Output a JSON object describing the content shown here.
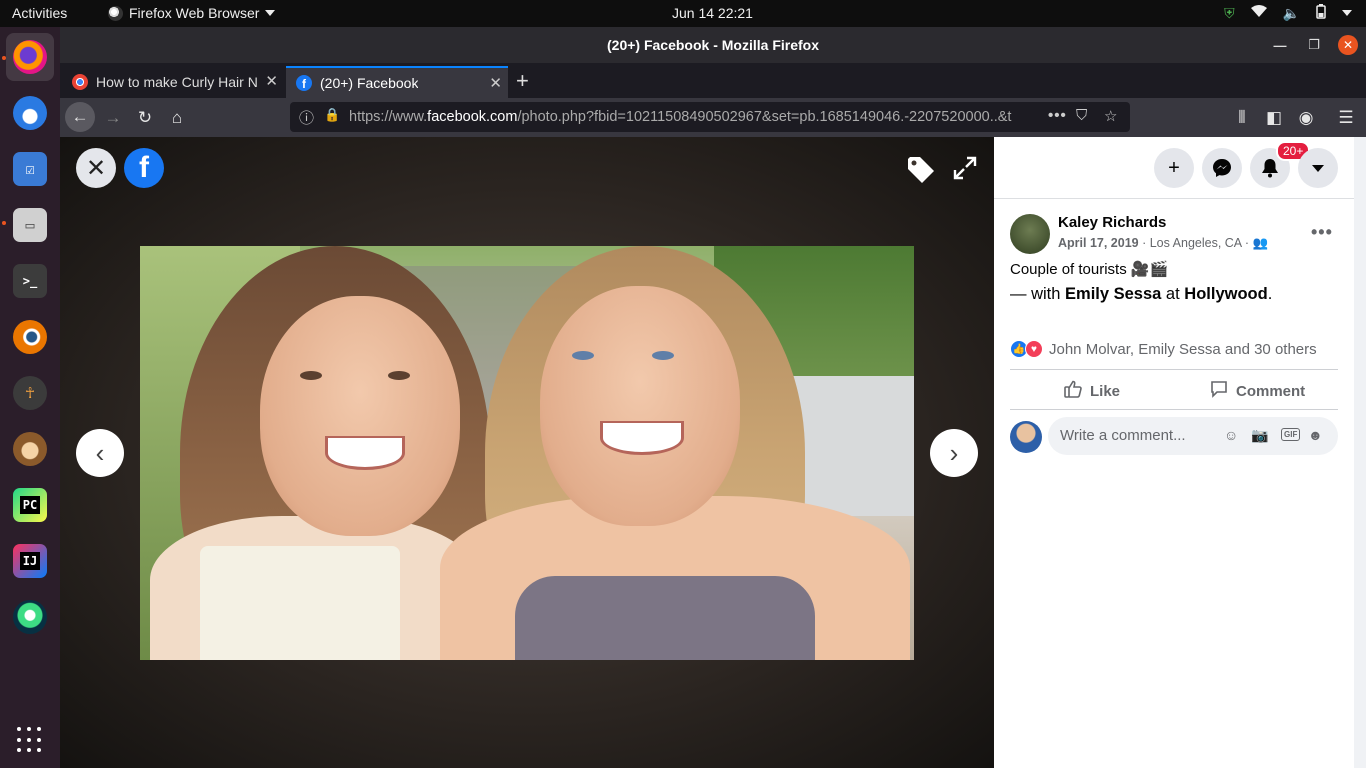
{
  "system": {
    "activities": "Activities",
    "app_menu": "Firefox Web Browser",
    "clock": "Jun 14  22:21"
  },
  "window": {
    "title": "(20+) Facebook - Mozilla Firefox"
  },
  "tabs": [
    {
      "label": "How to make Curly Hair N",
      "active": false
    },
    {
      "label": "(20+) Facebook",
      "active": true
    }
  ],
  "urlbar": {
    "url_prefix": "https://www.",
    "url_domain": "facebook.com",
    "url_rest": "/photo.php?fbid=10211508490502967&set=pb.1685149046.-2207520000..&t"
  },
  "panel": {
    "notification_count": "20+",
    "post": {
      "author": "Kaley Richards",
      "date": "April 17, 2019",
      "location": " · Los Angeles, CA · ",
      "caption": "Couple of tourists 🎥🎬",
      "with_prefix": "— with ",
      "tagged_person": "Emily Sessa",
      "at_text": " at ",
      "place": "Hollywood",
      "end_punct": ".",
      "reactions_text": "John Molvar, Emily Sessa and 30 others",
      "like_label": "Like",
      "comment_label": "Comment",
      "comment_placeholder": "Write a comment..."
    }
  },
  "colors": {
    "facebook_blue": "#1877f2",
    "badge_red": "#e41e3f",
    "ubuntu_orange": "#e95420"
  }
}
